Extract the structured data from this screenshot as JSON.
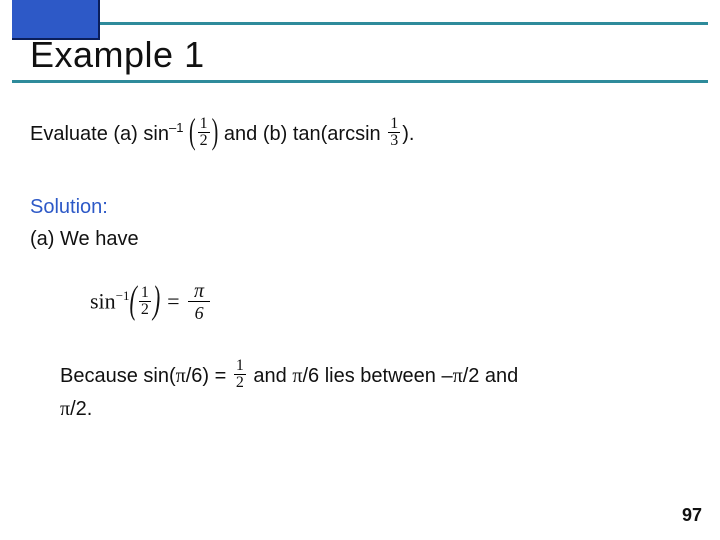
{
  "header": {
    "title": "Example 1"
  },
  "problem": {
    "prefix": "Evaluate (a) sin",
    "exp": "–1",
    "mid": "and (b) tan(arcsin ",
    "frac_a_num": "1",
    "frac_a_den": "2",
    "frac_b_num": "1",
    "frac_b_den": "3",
    "suffix": ")."
  },
  "solution": {
    "label": "Solution:",
    "part_a_intro": "(a) We have"
  },
  "equation": {
    "sin": "sin",
    "exp": "−1",
    "arg_num": "1",
    "arg_den": "2",
    "eq": " = ",
    "rhs_num": "π",
    "rhs_den": "6"
  },
  "because": {
    "a": "Because sin(",
    "pi1": "π",
    "b": "/6) = ",
    "half_num": "1",
    "half_den": "2",
    "c": " and ",
    "pi2": "π",
    "d": "/6 lies between –",
    "pi3": "π",
    "e": "/2 and ",
    "pi4": "π",
    "f": "/2."
  },
  "page": "97"
}
